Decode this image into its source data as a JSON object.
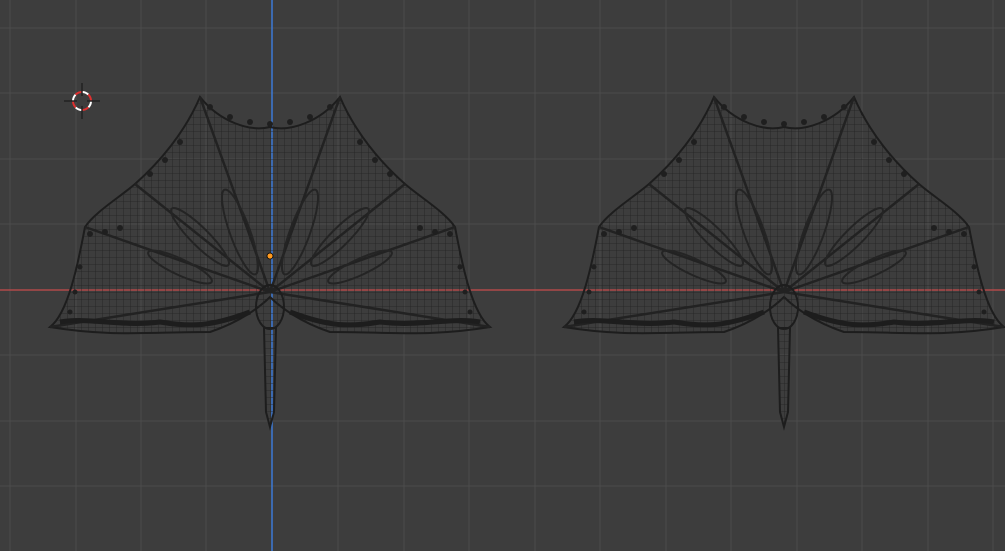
{
  "viewport": {
    "name": "3D Viewport",
    "background": "#3d3d3d",
    "grid_color": "#4b4b4b",
    "x_axis_color": "#b04a4a",
    "z_axis_color": "#3c7ad6",
    "wire_color": "#1f1f1f",
    "origin_color": "#ff9a1f",
    "cursor_colors": [
      "#ffffff",
      "#e03030"
    ]
  },
  "objects": [
    {
      "name": "wireframe-bat-left",
      "selected": true
    },
    {
      "name": "wireframe-bat-right",
      "selected": false
    }
  ],
  "icons": [
    "3d-cursor-icon",
    "object-origin-icon"
  ]
}
